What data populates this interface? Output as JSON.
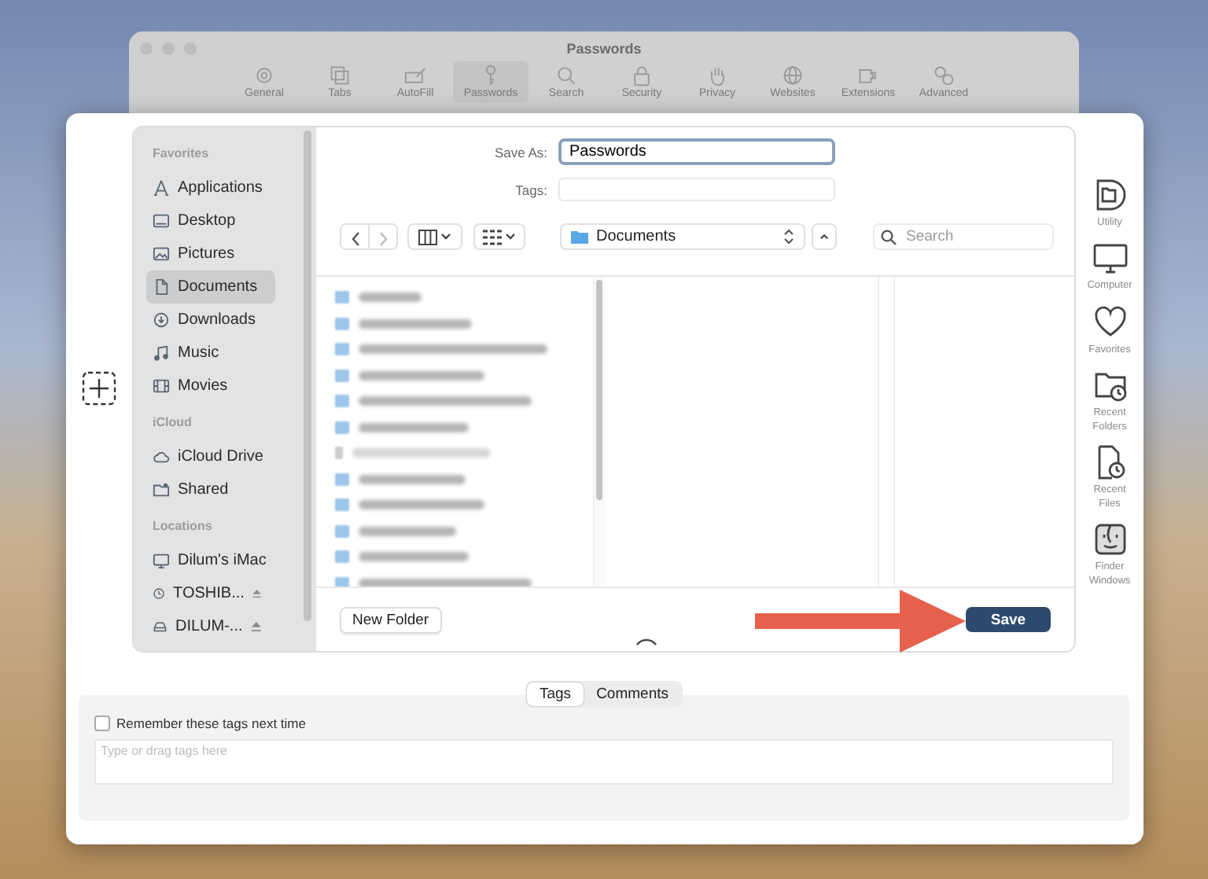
{
  "background_window": {
    "title": "Passwords",
    "toolbar": [
      {
        "label": "General",
        "selected": false
      },
      {
        "label": "Tabs",
        "selected": false
      },
      {
        "label": "AutoFill",
        "selected": false
      },
      {
        "label": "Passwords",
        "selected": true
      },
      {
        "label": "Search",
        "selected": false
      },
      {
        "label": "Security",
        "selected": false
      },
      {
        "label": "Privacy",
        "selected": false
      },
      {
        "label": "Websites",
        "selected": false
      },
      {
        "label": "Extensions",
        "selected": false
      },
      {
        "label": "Advanced",
        "selected": false
      }
    ]
  },
  "sidebar": {
    "sections": [
      {
        "heading": "Favorites",
        "items": [
          {
            "label": "Applications",
            "selected": false,
            "eject": false
          },
          {
            "label": "Desktop",
            "selected": false,
            "eject": false
          },
          {
            "label": "Pictures",
            "selected": false,
            "eject": false
          },
          {
            "label": "Documents",
            "selected": true,
            "eject": false
          },
          {
            "label": "Downloads",
            "selected": false,
            "eject": false
          },
          {
            "label": "Music",
            "selected": false,
            "eject": false
          },
          {
            "label": "Movies",
            "selected": false,
            "eject": false
          }
        ]
      },
      {
        "heading": "iCloud",
        "items": [
          {
            "label": "iCloud Drive",
            "selected": false,
            "eject": false
          },
          {
            "label": "Shared",
            "selected": false,
            "eject": false
          }
        ]
      },
      {
        "heading": "Locations",
        "items": [
          {
            "label": "Dilum's iMac",
            "selected": false,
            "eject": false
          },
          {
            "label": "TOSHIB...",
            "selected": false,
            "eject": true
          },
          {
            "label": "DILUM-...",
            "selected": false,
            "eject": true
          }
        ]
      }
    ]
  },
  "save_as": {
    "label": "Save As:",
    "value": "Passwords"
  },
  "tags_field": {
    "label": "Tags:"
  },
  "location": {
    "value": "Documents"
  },
  "search": {
    "placeholder": "Search"
  },
  "new_folder_button": "New Folder",
  "save_button": "Save",
  "side_icons": [
    {
      "label": "Utility"
    },
    {
      "label": "Computer"
    },
    {
      "label": "Favorites"
    },
    {
      "label": "Recent Folders"
    },
    {
      "label": "Recent Files"
    },
    {
      "label": "Finder Windows"
    }
  ],
  "tags_panel": {
    "tabs": [
      {
        "label": "Tags",
        "selected": true
      },
      {
        "label": "Comments",
        "selected": false
      }
    ],
    "remember": {
      "label": "Remember these tags next time",
      "checked": false
    },
    "tags_input": {
      "placeholder": "Type or drag tags here"
    }
  }
}
